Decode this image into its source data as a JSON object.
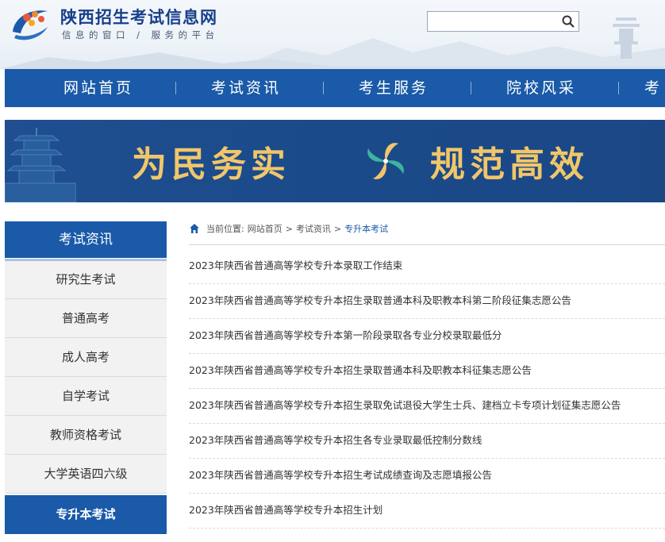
{
  "header": {
    "title": "陕西招生考试信息网",
    "slogan": "信息的窗口 / 服务的平台",
    "search": {
      "placeholder": "",
      "value": ""
    }
  },
  "nav": {
    "items": [
      "网站首页",
      "考试资讯",
      "考生服务",
      "院校风采",
      "考"
    ]
  },
  "banner": {
    "left_text": "为民务实",
    "right_text": "规范高效"
  },
  "sidebar": {
    "heading": "考试资讯",
    "items": [
      {
        "label": "研究生考试",
        "active": false
      },
      {
        "label": "普通高考",
        "active": false
      },
      {
        "label": "成人高考",
        "active": false
      },
      {
        "label": "自学考试",
        "active": false
      },
      {
        "label": "教师资格考试",
        "active": false
      },
      {
        "label": "大学英语四六级",
        "active": false
      },
      {
        "label": "专升本考试",
        "active": true
      }
    ]
  },
  "breadcrumb": {
    "prefix": "当前位置:",
    "items": [
      "网站首页",
      "考试资讯",
      "专升本考试"
    ],
    "separator": ">"
  },
  "articles": [
    "2023年陕西省普通高等学校专升本录取工作结束",
    "2023年陕西省普通高等学校专升本招生录取普通本科及职教本科第二阶段征集志愿公告",
    "2023年陕西省普通高等学校专升本第一阶段录取各专业分校录取最低分",
    "2023年陕西省普通高等学校专升本招生录取普通本科及职教本科征集志愿公告",
    "2023年陕西省普通高等学校专升本招生录取免试退役大学生士兵、建档立卡专项计划征集志愿公告",
    "2023年陕西省普通高等学校专升本招生各专业录取最低控制分数线",
    "2023年陕西省普通高等学校专升本招生考试成绩查询及志愿填报公告",
    "2023年陕西省普通高等学校专升本招生计划"
  ],
  "colors": {
    "primary": "#1a5aa8",
    "banner_text": "#f1c66a",
    "title": "#173f8a"
  },
  "icons": {
    "search": "search-icon",
    "home": "home-icon",
    "logo": "logo-emblem"
  }
}
